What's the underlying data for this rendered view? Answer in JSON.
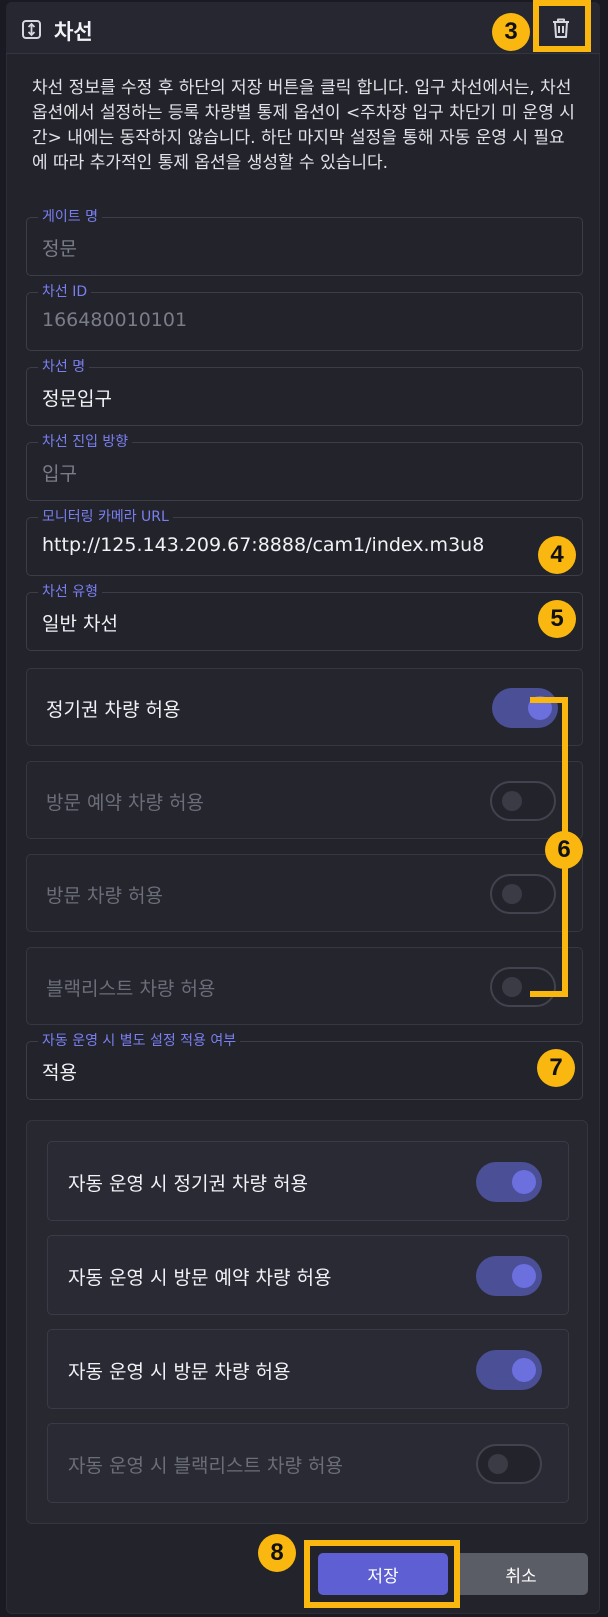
{
  "header": {
    "title": "차선"
  },
  "description": "차선 정보를 수정 후 하단의 저장 버튼을 클릭 합니다. 입구 차선에서는, 차선 옵션에서 설정하는 등록 차량별 통제 옵션이 <주차장 입구 차단기 미 운영 시간> 내에는 동작하지 않습니다. 하단 마지막 설정을 통해 자동 운영 시 필요에 따라 추가적인 통제 옵션을 생성할 수 있습니다.",
  "fields": [
    {
      "label": "게이트 명",
      "value": "정문",
      "editable": false
    },
    {
      "label": "차선 ID",
      "value": "166480010101",
      "editable": false
    },
    {
      "label": "차선 명",
      "value": "정문입구",
      "editable": true
    },
    {
      "label": "차선 진입 방향",
      "value": "입구",
      "editable": false
    },
    {
      "label": "모니터링 카메라 URL",
      "value": "http://125.143.209.67:8888/cam1/index.m3u8",
      "editable": true
    },
    {
      "label": "차선 유형",
      "value": "일반 차선",
      "editable": true
    },
    {
      "label": "자동 운영 시 별도 설정 적용 여부",
      "value": "적용",
      "editable": true
    }
  ],
  "toggles": [
    {
      "label": "정기권 차량 허용",
      "on": true,
      "enabled": true
    },
    {
      "label": "방문 예약 차량 허용",
      "on": false,
      "enabled": false
    },
    {
      "label": "방문 차량 허용",
      "on": false,
      "enabled": false
    },
    {
      "label": "블랙리스트 차량 허용",
      "on": false,
      "enabled": false
    }
  ],
  "auto_toggles": [
    {
      "label": "자동 운영 시 정기권 차량 허용",
      "on": true,
      "enabled": true
    },
    {
      "label": "자동 운영 시 방문 예약 차량 허용",
      "on": true,
      "enabled": true
    },
    {
      "label": "자동 운영 시 방문 차량 허용",
      "on": true,
      "enabled": true
    },
    {
      "label": "자동 운영 시 블랙리스트 차량 허용",
      "on": false,
      "enabled": false
    }
  ],
  "buttons": {
    "save": "저장",
    "cancel": "취소"
  },
  "callouts": {
    "trash": "3",
    "camera_url": "4",
    "lane_type": "5",
    "toggles": "6",
    "auto_setting": "7",
    "save": "8"
  },
  "colors": {
    "accent": "#5d5fd2",
    "label": "#7a7ff0",
    "callout": "#f9b70f",
    "background": "#22232b"
  }
}
